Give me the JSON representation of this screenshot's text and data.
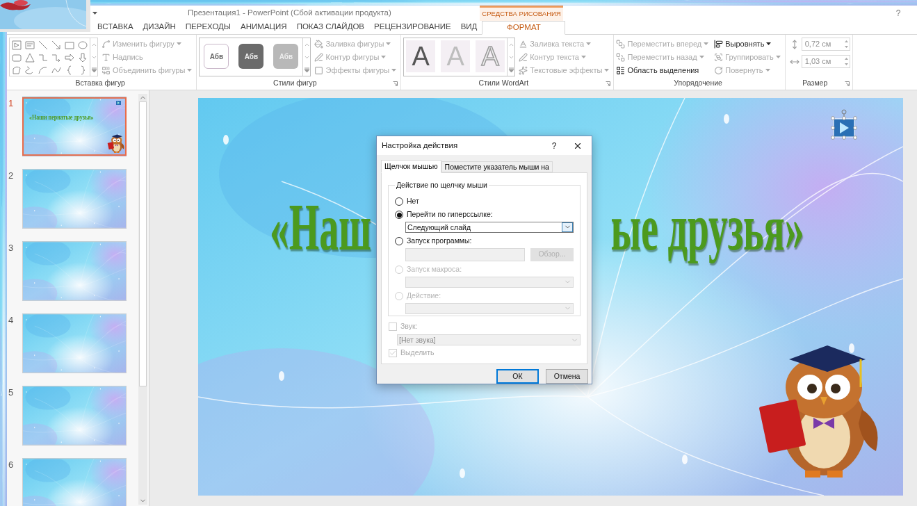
{
  "title_bar": {
    "title": "Презентация1 - PowerPoint (Сбой активации продукта)",
    "help": "?"
  },
  "ribbon_tabs": [
    {
      "label": "ВСТАВКА",
      "selected": false
    },
    {
      "label": "ДИЗАЙН",
      "selected": false
    },
    {
      "label": "ПЕРЕХОДЫ",
      "selected": false
    },
    {
      "label": "АНИМАЦИЯ",
      "selected": false
    },
    {
      "label": "ПОКАЗ СЛАЙДОВ",
      "selected": false
    },
    {
      "label": "РЕЦЕНЗИРОВАНИЕ",
      "selected": false
    },
    {
      "label": "ВИД",
      "selected": false
    },
    {
      "label": "ФОРМАТ",
      "selected": true,
      "context": "СРЕДСТВА РИСОВАНИЯ"
    }
  ],
  "ribbon_groups": [
    {
      "title": "Вставка фигур",
      "gallery": {
        "kind": "shapes"
      },
      "launcher": false,
      "commands": [
        {
          "label": "Изменить фигуру",
          "disabled": true,
          "menu": true
        },
        {
          "label": "Надпись",
          "disabled": true,
          "menu": false
        },
        {
          "label": "Объединить фигуры",
          "disabled": true,
          "menu": true
        }
      ]
    },
    {
      "title": "Стили фигур",
      "gallery": {
        "kind": "shape_styles",
        "items": [
          {
            "label": "Абв"
          },
          {
            "label": "Абв"
          },
          {
            "label": "Абв"
          }
        ]
      },
      "launcher": true,
      "commands": [
        {
          "label": "Заливка фигуры",
          "disabled": true,
          "menu": true
        },
        {
          "label": "Контур фигуры",
          "disabled": true,
          "menu": true
        },
        {
          "label": "Эффекты фигуры",
          "disabled": true,
          "menu": true
        }
      ]
    },
    {
      "title": "Стили WordArt",
      "gallery": {
        "kind": "wordart",
        "items": [
          {
            "label": "A"
          },
          {
            "label": "A"
          },
          {
            "label": "A"
          }
        ]
      },
      "launcher": true,
      "commands": [
        {
          "label": "Заливка текста",
          "disabled": true,
          "menu": true
        },
        {
          "label": "Контур текста",
          "disabled": true,
          "menu": true
        },
        {
          "label": "Текстовые эффекты",
          "disabled": true,
          "menu": true
        }
      ]
    },
    {
      "title": "Упорядочение",
      "launcher": false,
      "commands": [
        {
          "label": "Переместить вперед",
          "disabled": true,
          "menu": true
        },
        {
          "label": "Переместить назад",
          "disabled": true,
          "menu": true
        },
        {
          "label": "Область выделения",
          "disabled": false,
          "menu": false
        },
        {
          "label": "Выровнять",
          "disabled": false,
          "menu": true
        },
        {
          "label": "Группировать",
          "disabled": true,
          "menu": true
        },
        {
          "label": "Повернуть",
          "disabled": true,
          "menu": true
        }
      ]
    },
    {
      "title": "Размер",
      "launcher": true,
      "fields": [
        {
          "value": "0,72 см",
          "kind": "height",
          "disabled": true
        },
        {
          "value": "1,03 см",
          "kind": "width",
          "disabled": true
        }
      ]
    }
  ],
  "slides": [
    {
      "number": "1",
      "selected": true,
      "title": "«Наши пернатые друзья»"
    },
    {
      "number": "2",
      "selected": false
    },
    {
      "number": "3",
      "selected": false
    },
    {
      "number": "4",
      "selected": false
    },
    {
      "number": "5",
      "selected": false
    },
    {
      "number": "6",
      "selected": false
    }
  ],
  "slide": {
    "title_left": "«Наш",
    "title_right": "ые друзья»"
  },
  "dialog": {
    "title": "Настройка действия",
    "help": "?",
    "tabs": [
      {
        "label": "Щелчок мышью",
        "selected": true
      },
      {
        "label": "Поместите указатель мыши на",
        "selected": false
      }
    ],
    "group": {
      "legend": "Действие по щелчку мыши",
      "options": [
        {
          "label": "Нет",
          "selected": false,
          "disabled": false
        },
        {
          "label": "Перейти по гиперссылке:",
          "selected": true,
          "disabled": false,
          "control": {
            "kind": "dropdown",
            "value": "Следующий слайд",
            "disabled": false,
            "focused": true
          }
        },
        {
          "label": "Запуск программы:",
          "selected": false,
          "disabled": false,
          "control": {
            "kind": "path",
            "disabled": true,
            "button": "Обзор..."
          }
        },
        {
          "label": "Запуск макроса:",
          "selected": false,
          "disabled": true,
          "control": {
            "kind": "dropdown",
            "disabled": true,
            "focused": false
          }
        },
        {
          "label": "Действие:",
          "selected": false,
          "disabled": true,
          "control": {
            "kind": "dropdown",
            "disabled": true,
            "focused": false
          }
        }
      ]
    },
    "sound": {
      "label": "Звук:",
      "checked": false,
      "value": "[Нет звука]",
      "disabled": true
    },
    "highlight": {
      "label": "Выделить",
      "checked": true,
      "disabled": true
    },
    "buttons": [
      {
        "label": "ОК",
        "default": true
      },
      {
        "label": "Отмена",
        "default": false
      }
    ]
  }
}
